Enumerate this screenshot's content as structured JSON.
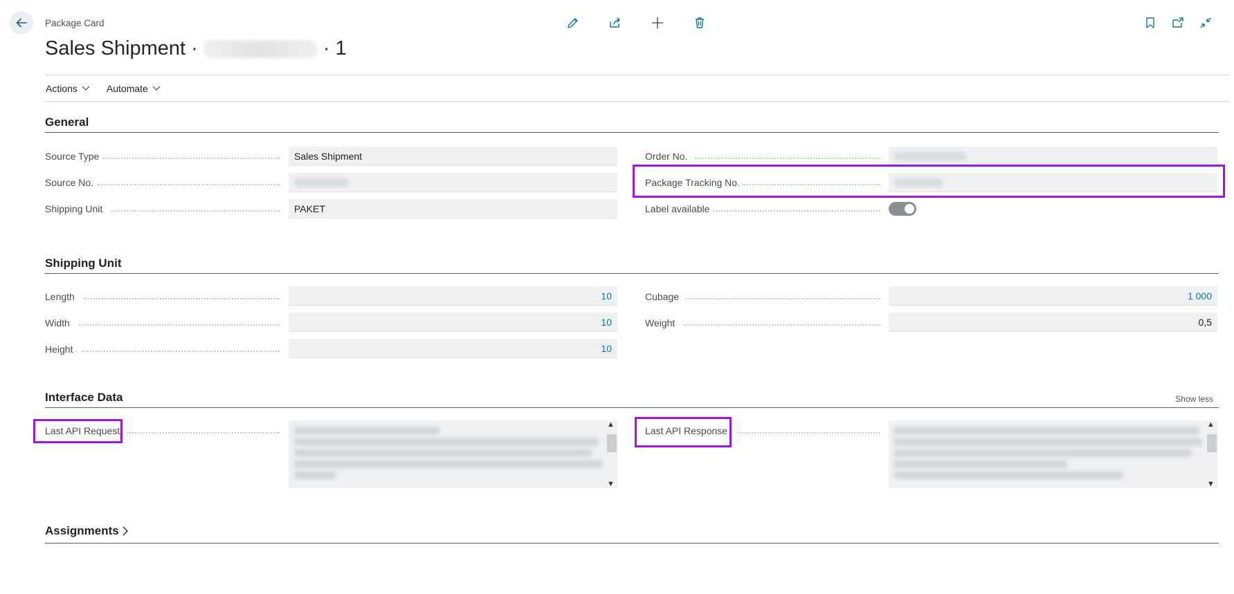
{
  "header": {
    "caption": "Package Card",
    "title_prefix": "Sales Shipment",
    "title_separator": "·",
    "title_suffix": "1"
  },
  "toolbar": {
    "center_icons": [
      "edit-icon",
      "share-icon",
      "add-icon",
      "delete-icon"
    ],
    "right_icons": [
      "bookmark-icon",
      "open-new-window-icon",
      "collapse-icon"
    ]
  },
  "actionbar": {
    "actions_label": "Actions",
    "automate_label": "Automate"
  },
  "general": {
    "title": "General",
    "source_type_label": "Source Type",
    "source_type_value": "Sales Shipment",
    "source_no_label": "Source No.",
    "shipping_unit_label": "Shipping Unit",
    "shipping_unit_value": "PAKET",
    "order_no_label": "Order No.",
    "package_tracking_label": "Package Tracking No.",
    "label_available_label": "Label available",
    "label_available_value": true
  },
  "shipping_unit": {
    "title": "Shipping Unit",
    "length_label": "Length",
    "length_value": "10",
    "width_label": "Width",
    "width_value": "10",
    "height_label": "Height",
    "height_value": "10",
    "cubage_label": "Cubage",
    "cubage_value": "1 000",
    "weight_label": "Weight",
    "weight_value": "0,5"
  },
  "interface_data": {
    "title": "Interface Data",
    "show_less_label": "Show less",
    "last_api_request_label": "Last API Request",
    "last_api_response_label": "Last API Response"
  },
  "assignments": {
    "title": "Assignments"
  },
  "colors": {
    "accent": "#0e7a8a",
    "highlight": "#9b16e0",
    "field_bg": "#eef0f1"
  }
}
